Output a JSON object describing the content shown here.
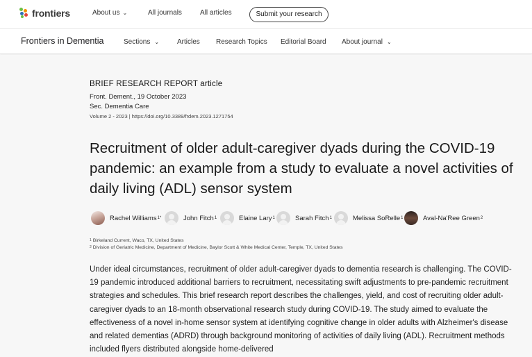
{
  "topbar": {
    "logo_text": "frontiers",
    "nav": [
      {
        "label": "About us",
        "has_chevron": true
      },
      {
        "label": "All journals",
        "has_chevron": false
      },
      {
        "label": "All articles",
        "has_chevron": false
      }
    ],
    "submit_label": "Submit your research"
  },
  "subbar": {
    "journal_name": "Frontiers in Dementia",
    "nav": [
      {
        "label": "Sections",
        "has_chevron": true
      },
      {
        "label": "Articles",
        "has_chevron": false
      },
      {
        "label": "Research Topics",
        "has_chevron": false
      },
      {
        "label": "Editorial Board",
        "has_chevron": false
      },
      {
        "label": "About journal",
        "has_chevron": true
      }
    ]
  },
  "article": {
    "type": "BRIEF RESEARCH REPORT article",
    "journal_date": "Front. Dement., 19 October 2023",
    "section": "Sec. Dementia Care",
    "volume_doi": "Volume 2 - 2023 | https://doi.org/10.3389/frdem.2023.1271754",
    "title": "Recruitment of older adult-caregiver dyads during the COVID-19 pandemic: an example from a study to evaluate a novel activities of daily living (ADL) sensor system",
    "authors": [
      {
        "name": "Rachel Williams",
        "sup": "1*",
        "avatar": "photo"
      },
      {
        "name": "John Fitch",
        "sup": "1",
        "avatar": "placeholder"
      },
      {
        "name": "Elaine Lary",
        "sup": "1",
        "avatar": "placeholder"
      },
      {
        "name": "Sarah Fitch",
        "sup": "1",
        "avatar": "placeholder"
      },
      {
        "name": "Melissa SoRelle",
        "sup": "1",
        "avatar": "placeholder"
      },
      {
        "name": "Aval-Na'Ree Green",
        "sup": "2",
        "avatar": "photo"
      }
    ],
    "affiliations": [
      {
        "sup": "1",
        "text": "Birkeland Current, Waco, TX, United States"
      },
      {
        "sup": "2",
        "text": "Division of Geriatric Medicine, Department of Medicine, Baylor Scott & White Medical Center, Temple, TX, United States"
      }
    ],
    "abstract": "Under ideal circumstances, recruitment of older adult-caregiver dyads to dementia research is challenging. The COVID-19 pandemic introduced additional barriers to recruitment, necessitating swift adjustments to pre-pandemic recruitment strategies and schedules. This brief research report describes the challenges, yield, and cost of recruiting older adult-caregiver dyads to an 18-month observational research study during COVID-19. The study aimed to evaluate the effectiveness of a novel in-home sensor system at identifying cognitive change in older adults with Alzheimer's disease and related dementias (ADRD) through background monitoring of activities of daily living (ADL). Recruitment methods included flyers distributed alongside home-delivered"
  },
  "colors": {
    "page_bg": "#f7f7f7",
    "header_bg": "#ffffff",
    "text": "#1a1a1a",
    "logo_green": "#6cbf44",
    "logo_orange": "#f29100",
    "logo_blue": "#2f6fb6",
    "logo_red": "#e2453c"
  }
}
